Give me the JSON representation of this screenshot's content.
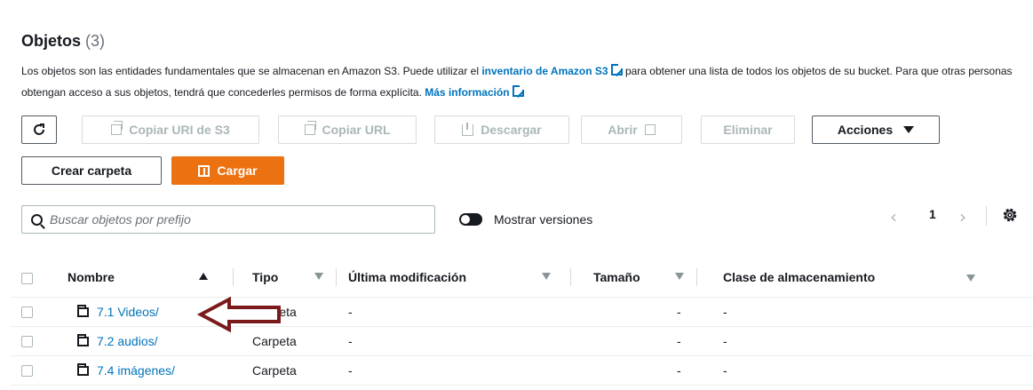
{
  "header": {
    "title": "Objetos",
    "count": "(3)"
  },
  "description": {
    "part1": "Los objetos son las entidades fundamentales que se almacenan en Amazon S3. Puede utilizar el ",
    "link1": "inventario de Amazon S3",
    "part2": " para obtener una lista de todos los objetos de su bucket. Para que otras personas obtengan acceso a sus objetos, tendrá que concederles permisos de forma explícita. ",
    "link2": "Más información"
  },
  "toolbar": {
    "copy_s3_uri": "Copiar URI de S3",
    "copy_url": "Copiar URL",
    "download": "Descargar",
    "open": "Abrir",
    "delete": "Eliminar",
    "actions": "Acciones",
    "create_folder": "Crear carpeta",
    "upload": "Cargar"
  },
  "search": {
    "placeholder": "Buscar objetos por prefijo"
  },
  "versions_toggle": {
    "label": "Mostrar versiones",
    "on": true
  },
  "pagination": {
    "current_page": "1"
  },
  "table": {
    "headers": {
      "name": "Nombre",
      "type": "Tipo",
      "modified": "Última modificación",
      "size": "Tamaño",
      "storage_class": "Clase de almacenamiento"
    },
    "rows": [
      {
        "name": "7.1 Videos/",
        "type": "Carpeta",
        "modified": "-",
        "size": "-",
        "storage_class": "-"
      },
      {
        "name": "7.2 audios/",
        "type": "Carpeta",
        "modified": "-",
        "size": "-",
        "storage_class": "-"
      },
      {
        "name": "7.4 imágenes/",
        "type": "Carpeta",
        "modified": "-",
        "size": "-",
        "storage_class": "-"
      }
    ]
  },
  "colors": {
    "link": "#0073bb",
    "primary": "#ec7211",
    "annotation_arrow": "#7b1a1a"
  },
  "icons": [
    "refresh-icon",
    "copy-icon",
    "download-icon",
    "external-link-icon",
    "upload-icon",
    "search-icon",
    "settings-gear-icon",
    "folder-icon",
    "sort-ascending-icon",
    "sort-descending-icon",
    "annotation-arrow"
  ]
}
